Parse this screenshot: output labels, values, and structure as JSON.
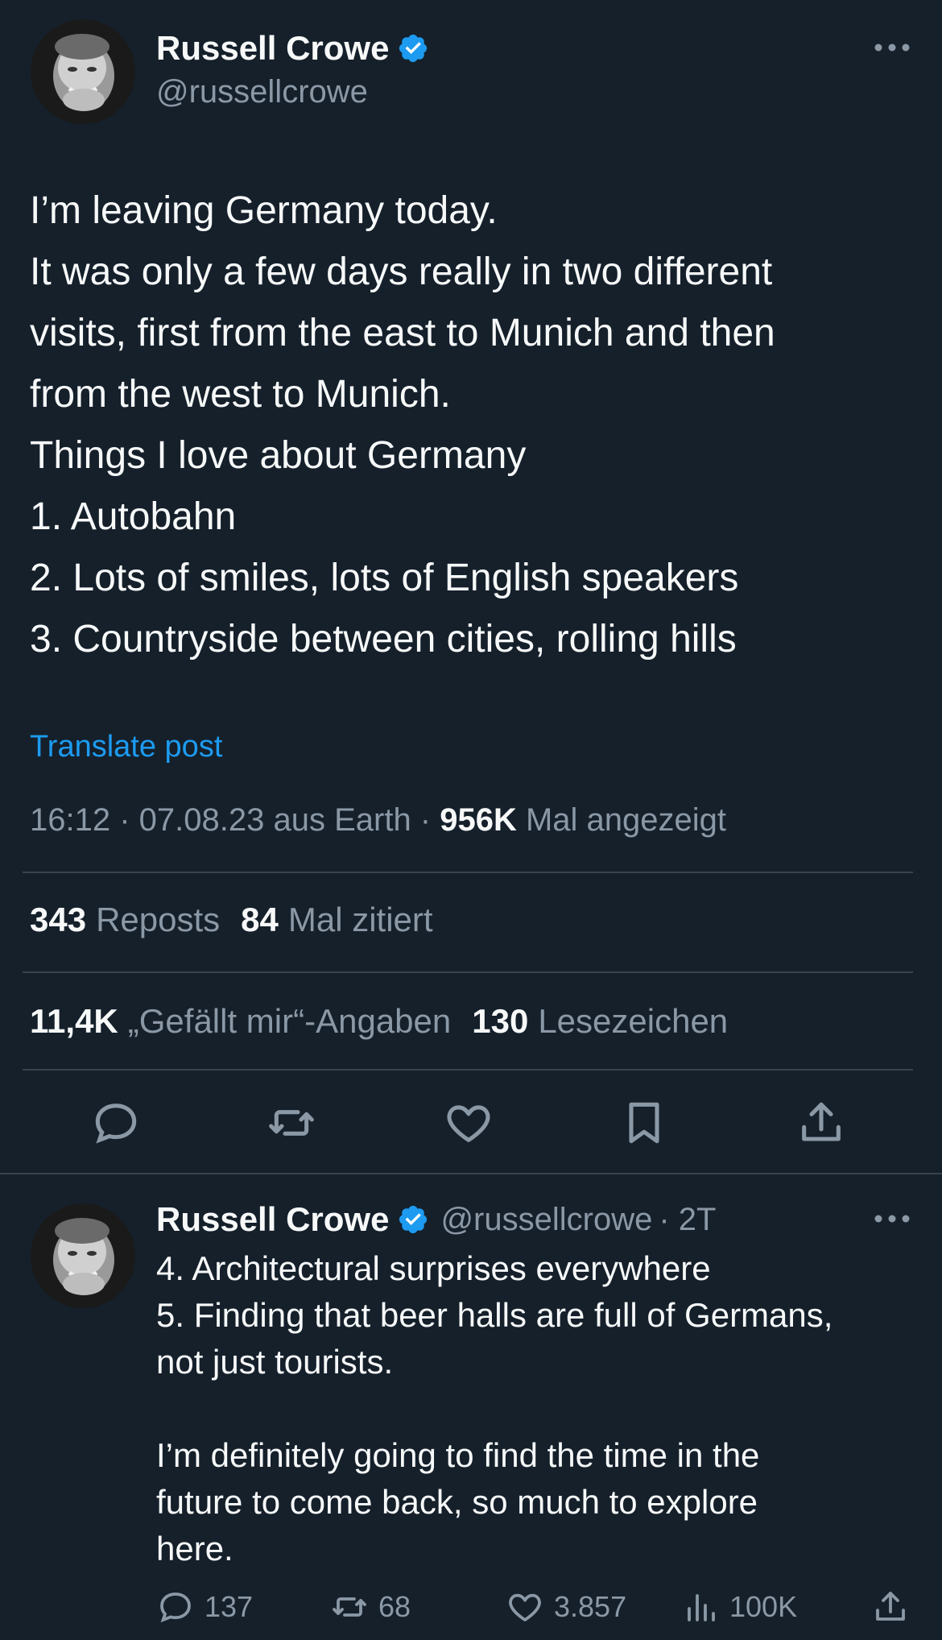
{
  "post": {
    "author_name": "Russell Crowe",
    "author_handle": "@russellcrowe",
    "verified_icon": "verified-badge-icon",
    "text_lines": [
      "I’m leaving Germany today.",
      "It was only a few days really in two different",
      "visits, first from the east to Munich and then",
      "from the west to Munich.",
      "Things I love about Germany",
      "1. Autobahn",
      "2. Lots of smiles, lots of English speakers",
      "3. Countryside between cities, rolling hills"
    ],
    "translate_label": "Translate post",
    "meta": {
      "time": "16:12",
      "sep1": " · ",
      "date_source": "07.08.23 aus Earth",
      "sep2": " · ",
      "views_count": "956K",
      "views_label": " Mal angezeigt"
    },
    "stats": {
      "reposts_count": "343",
      "reposts_label": "Reposts",
      "quotes_count": "84",
      "quotes_label": "Mal zitiert",
      "likes_count": "11,4K",
      "likes_label": "„Gefällt mir“-Angaben",
      "bookmarks_count": "130",
      "bookmarks_label": "Lesezeichen"
    },
    "actions": [
      "reply-icon",
      "repost-icon",
      "like-icon",
      "bookmark-icon",
      "share-icon"
    ]
  },
  "reply": {
    "author_name": "Russell Crowe",
    "author_handle": "@russellcrowe",
    "time": "· 2T",
    "text_lines": [
      "4. Architectural surprises everywhere",
      "5. Finding that beer halls are full of Germans,",
      "not just tourists.",
      "",
      "I’m definitely going to find the time in the",
      "future to come back, so much to explore",
      "here."
    ],
    "actions": {
      "replies": "137",
      "reposts": "68",
      "likes": "3.857",
      "views": "100K"
    }
  },
  "colors": {
    "background": "#15202b",
    "text": "#f7f9f9",
    "secondary": "#8b98a5",
    "accent": "#1d9bf0",
    "divider": "#38444d"
  }
}
